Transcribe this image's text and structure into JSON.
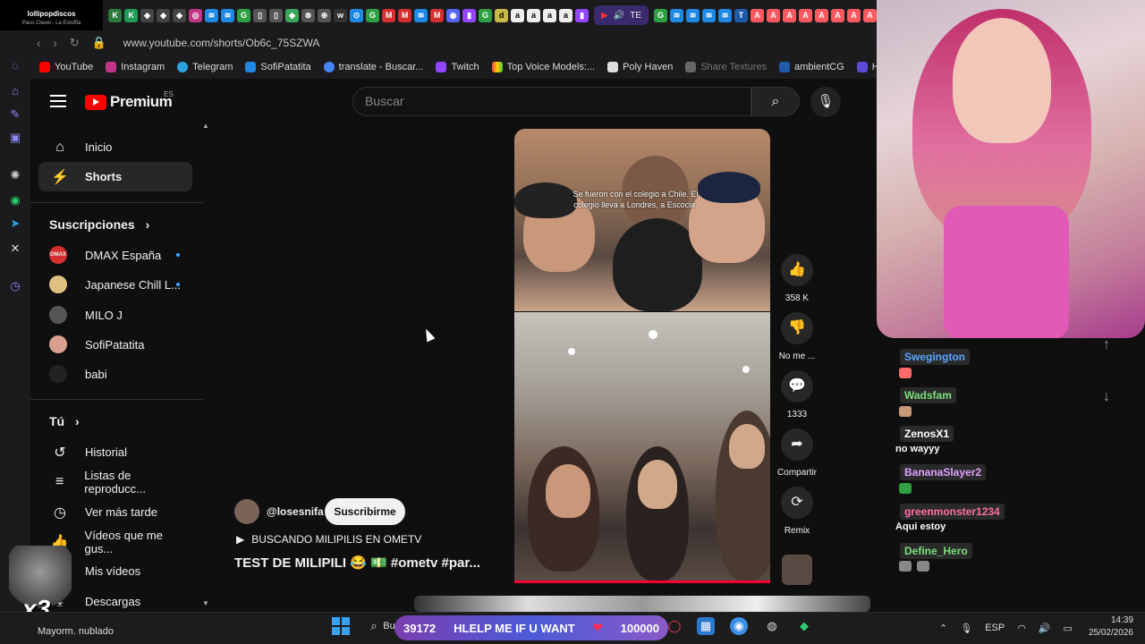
{
  "browser": {
    "now_playing": {
      "title": "lollipopdiscos",
      "subtitle": "Paco Clavel - La Estuffia"
    },
    "tab_label": "TE",
    "url": "www.youtube.com/shorts/Ob6c_75SZWA",
    "bookmarks": [
      "YouTube",
      "Instagram",
      "Telegram",
      "SofiPatatita",
      "translate - Buscar...",
      "Twitch",
      "Top Voice Models:...",
      "Poly Haven",
      "Share Textures",
      "ambientCG",
      "Ha"
    ]
  },
  "youtube": {
    "logo": "Premium",
    "logo_region": "ES",
    "search_placeholder": "Buscar",
    "nav": [
      {
        "label": "Inicio",
        "icon": "home-icon"
      },
      {
        "label": "Shorts",
        "icon": "shorts-icon"
      }
    ],
    "subscriptions_header": "Suscripciones",
    "subscriptions": [
      {
        "label": "DMAX España",
        "new": true,
        "color": "#d32f2f"
      },
      {
        "label": "Japanese Chill L...",
        "new": true,
        "color": "#e0c080"
      },
      {
        "label": "MILO J",
        "new": false,
        "color": "#555555"
      },
      {
        "label": "SofiPatatita",
        "new": false,
        "color": "#d9a090"
      },
      {
        "label": "babi",
        "new": false,
        "color": "#222222"
      }
    ],
    "you_header": "Tú",
    "you_items": [
      {
        "label": "Historial",
        "icon": "history-icon"
      },
      {
        "label": "Listas de reproducc...",
        "icon": "playlists-icon"
      },
      {
        "label": "Ver más tarde",
        "icon": "clock-icon"
      },
      {
        "label": "Vídeos que me gus...",
        "icon": "thumbs-up-icon"
      },
      {
        "label": "Mis vídeos",
        "icon": "my-videos-icon"
      },
      {
        "label": "Descargas",
        "icon": "download-icon"
      }
    ],
    "short": {
      "caption": "Se fueron con el colegio a Chile. El colegio lleva a Londres, a Escocia,",
      "channel": "@losesnifa",
      "subscribe": "Suscribirme",
      "music": "BUSCANDO MILIPILIS EN OMETV",
      "title": "TEST DE MILIPILI 😂 💵 #ometv #par...",
      "likes": "358 K",
      "dislike_label": "No me ...",
      "comments": "1333",
      "share": "Compartir",
      "remix": "Remix"
    }
  },
  "chat": [
    {
      "name": "Swegington",
      "color": "#5aa6ff",
      "msg": ""
    },
    {
      "name": "Wadsfam",
      "color": "#7ae07a",
      "msg": ""
    },
    {
      "name": "ZenosX1",
      "color": "#ffffff",
      "msg": "no wayyy"
    },
    {
      "name": "BananaSlayer2",
      "color": "#e0a0ff",
      "msg": ""
    },
    {
      "name": "greenmonster1234",
      "color": "#ff6fa8",
      "msg": "Aqui estoy"
    },
    {
      "name": "Define_Hero",
      "color": "#7ae07a",
      "msg": ""
    }
  ],
  "overlay": {
    "sticker": "x3"
  },
  "taskbar": {
    "weather": "Mayorm. nublado",
    "counter_left": "39172",
    "counter_text": "HLELP ME IF U WANT",
    "counter_right": "100000",
    "search_hint": "Bu",
    "lang": "ESP",
    "time": "14:39",
    "date": "25/02/2026"
  }
}
